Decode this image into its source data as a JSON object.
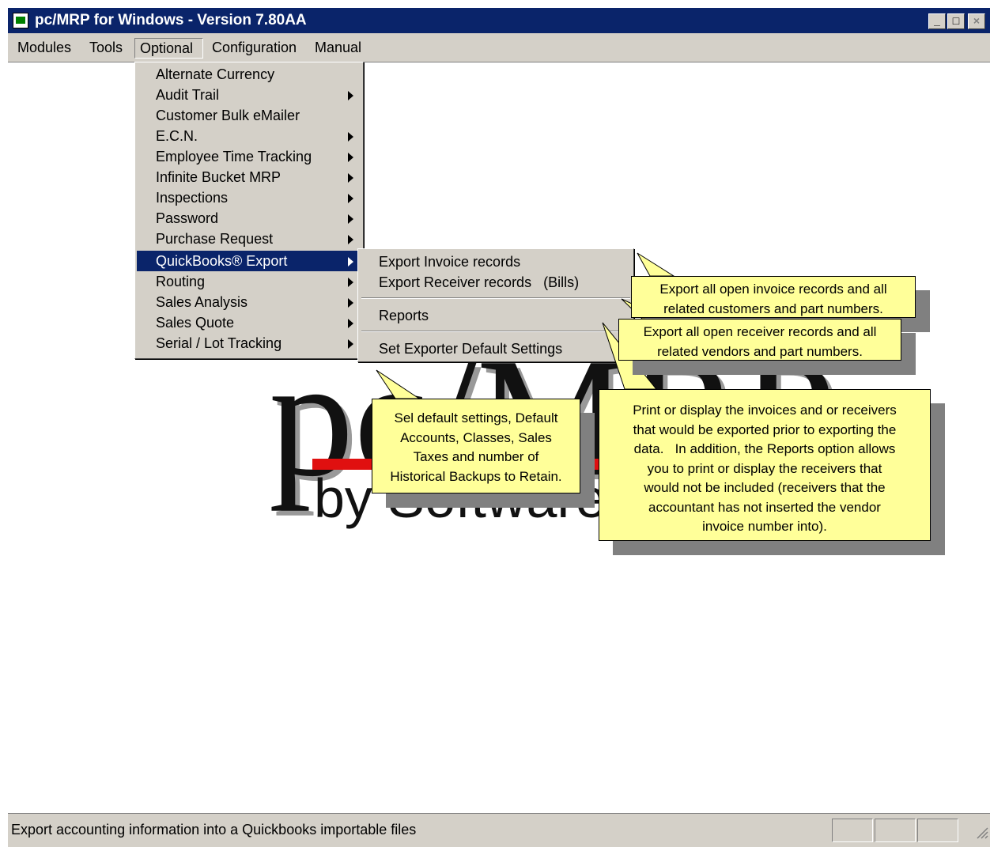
{
  "window": {
    "title": "pc/MRP for Windows - Version 7.80AA",
    "minimize_glyph": "_",
    "maximize_glyph": "□",
    "close_glyph": "×"
  },
  "menubar": {
    "items": [
      "Modules",
      "Tools",
      "Optional",
      "Configuration",
      "Manual"
    ],
    "open_item": "Optional"
  },
  "optional_menu": {
    "items": [
      {
        "label": "Alternate Currency",
        "has_submenu": false
      },
      {
        "label": "Audit Trail",
        "has_submenu": true
      },
      {
        "label": "Customer Bulk eMailer",
        "has_submenu": false
      },
      {
        "label": "E.C.N.",
        "has_submenu": true
      },
      {
        "label": "Employee Time Tracking",
        "has_submenu": true
      },
      {
        "label": "Infinite Bucket MRP",
        "has_submenu": true
      },
      {
        "label": "Inspections",
        "has_submenu": true
      },
      {
        "label": "Password",
        "has_submenu": true
      },
      {
        "label": "Purchase Request",
        "has_submenu": true
      },
      {
        "label": "QuickBooks® Export",
        "has_submenu": true,
        "selected": true
      },
      {
        "label": "Routing",
        "has_submenu": true
      },
      {
        "label": "Sales Analysis",
        "has_submenu": true
      },
      {
        "label": "Sales Quote",
        "has_submenu": true
      },
      {
        "label": "Serial / Lot Tracking",
        "has_submenu": true
      }
    ]
  },
  "quickbooks_submenu": {
    "items": [
      {
        "label": "Export Invoice records"
      },
      {
        "label": "Export Receiver records   (Bills)"
      },
      {
        "label": "Reports"
      },
      {
        "label": "Set Exporter Default Settings"
      }
    ]
  },
  "callouts": {
    "invoice": [
      "Export all open invoice records and all",
      "related customers and part numbers."
    ],
    "receiver": [
      "Export all open receiver records and all",
      "related vendors and part numbers."
    ],
    "defaults": [
      "Sel default settings, Default",
      "Accounts, Classes, Sales",
      "Taxes and number of",
      "Historical Backups to Retain."
    ],
    "reports": [
      "Print or display the invoices and or receivers",
      "that would be exported prior to exporting the",
      "data.   In addition, the Reports option allows",
      "you to print or display the receivers that",
      "would not be included (receivers that the",
      "accountant has not inserted the vendor",
      "invoice number into)."
    ]
  },
  "logo": {
    "text_main": "pc/MRP",
    "text_by": "by Software A",
    "bar_color": "#e01010"
  },
  "statusbar": {
    "text": "Export accounting information into a Quickbooks importable files"
  },
  "colors": {
    "titlebar": "#0a246a",
    "menu_bg": "#d4d0c8",
    "selection": "#0a246a",
    "callout_bg": "#ffff99"
  }
}
